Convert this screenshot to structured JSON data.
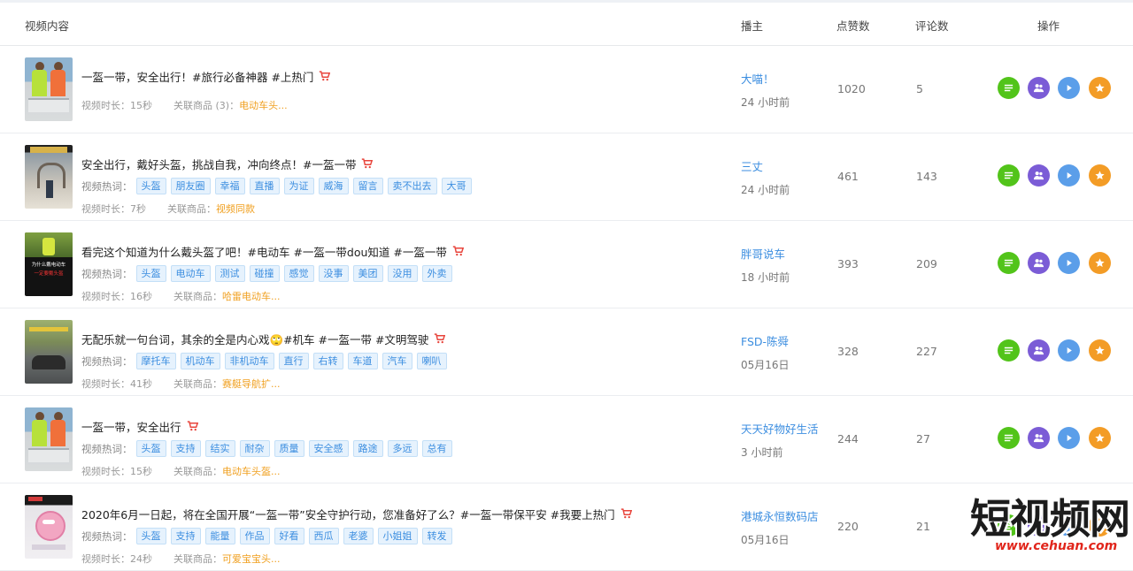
{
  "header": {
    "col_video": "视频内容",
    "col_anchor": "播主",
    "col_likes": "点赞数",
    "col_comments": "评论数",
    "col_ops": "操作"
  },
  "labels": {
    "hotwords": "视频热词：",
    "duration_prefix": "视频时长：",
    "goods_prefix": "关联商品："
  },
  "icons": {
    "cart": "shopping-cart-icon",
    "op1": "detail-list-icon",
    "op2": "fans-users-icon",
    "op3": "play-icon",
    "op4": "star-favorite-icon"
  },
  "colors": {
    "link": "#3c8ee0",
    "goods": "#f0a020",
    "cart": "#e8453c",
    "op_green": "#52c41a",
    "op_purple": "#7b5cd6",
    "op_blue": "#5b9ee9",
    "op_orange": "#f39c26"
  },
  "rows": [
    {
      "thumb": "people",
      "title": "一盔一带，安全出行！#旅行必备神器 #上热门",
      "tags": [],
      "duration": "15秒",
      "goods_label": "关联商品 (3)：",
      "goods": "电动车头...",
      "anchor": "大喵！",
      "time": "24 小时前",
      "likes": "1020",
      "comments": "5"
    },
    {
      "thumb": "gate",
      "title": "安全出行，戴好头盔，挑战自我，冲向终点！#一盔一带",
      "tags": [
        "头盔",
        "朋友圈",
        "幸福",
        "直播",
        "为证",
        "威海",
        "留言",
        "卖不出去",
        "大哥"
      ],
      "duration": "7秒",
      "goods_label": "关联商品：",
      "goods": "视频同款",
      "anchor": "三丈",
      "time": "24 小时前",
      "likes": "461",
      "comments": "143"
    },
    {
      "thumb": "dark",
      "thumb_text": "为什么戴电动车",
      "thumb_text2": "一定要戴头盔",
      "title": "看完这个知道为什么戴头盔了吧！#电动车 #一盔一带dou知道 #一盔一带",
      "tags": [
        "头盔",
        "电动车",
        "测试",
        "碰撞",
        "感觉",
        "没事",
        "美团",
        "没用",
        "外卖"
      ],
      "duration": "16秒",
      "goods_label": "关联商品：",
      "goods": "哈雷电动车...",
      "anchor": "胖哥说车",
      "time": "18 小时前",
      "likes": "393",
      "comments": "209"
    },
    {
      "thumb": "road",
      "title": "无配乐就一句台词，其余的全是内心戏🙄#机车 #一盔一带 #文明驾驶",
      "tags": [
        "摩托车",
        "机动车",
        "非机动车",
        "直行",
        "右转",
        "车道",
        "汽车",
        "喇叭"
      ],
      "duration": "41秒",
      "goods_label": "关联商品：",
      "goods": "赛艇导航扩...",
      "anchor": "FSD-陈舜",
      "time": "05月16日",
      "likes": "328",
      "comments": "227"
    },
    {
      "thumb": "people",
      "title": "一盔一带，安全出行",
      "tags": [
        "头盔",
        "支持",
        "结实",
        "耐杂",
        "质量",
        "安全感",
        "路途",
        "多远",
        "总有"
      ],
      "duration": "15秒",
      "goods_label": "关联商品：",
      "goods": "电动车头盔...",
      "anchor": "天天好物好生活",
      "time": "3 小时前",
      "likes": "244",
      "comments": "27"
    },
    {
      "thumb": "pink",
      "title": "2020年6月一日起，将在全国开展“一盔一带”安全守护行动，您准备好了么？#一盔一带保平安 #我要上热门",
      "tags": [
        "头盔",
        "支持",
        "能量",
        "作品",
        "好看",
        "西瓜",
        "老婆",
        "小姐姐",
        "转发"
      ],
      "duration": "24秒",
      "goods_label": "关联商品：",
      "goods": "可爱宝宝头...",
      "anchor": "港城永恒数码店",
      "time": "05月16日",
      "likes": "220",
      "comments": "21"
    }
  ],
  "watermark": {
    "title": "短视频网",
    "url": "www.cehuan.com"
  }
}
